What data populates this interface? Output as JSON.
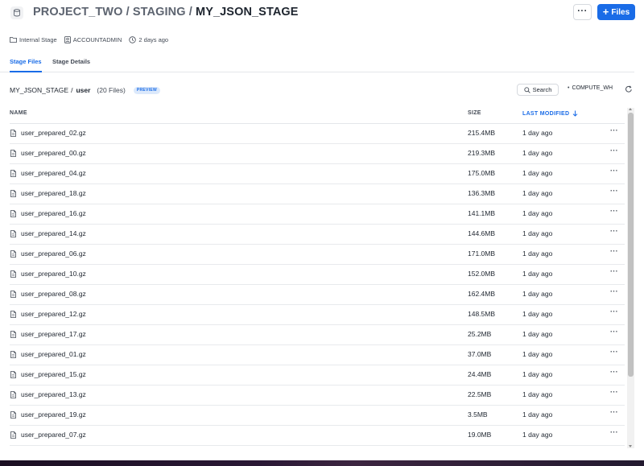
{
  "header": {
    "breadcrumb_db": "PROJECT_TWO",
    "breadcrumb_sep1": "/",
    "breadcrumb_schema": "STAGING",
    "breadcrumb_sep2": "/",
    "stage_name": "MY_JSON_STAGE",
    "more_label": "···",
    "files_button_label": "Files"
  },
  "meta": {
    "stage_type": "Internal Stage",
    "owner": "ACCOUNTADMIN",
    "created": "2 days ago"
  },
  "tabs": [
    {
      "label": "Stage Files",
      "active": true
    },
    {
      "label": "Stage Details",
      "active": false
    }
  ],
  "path": {
    "stage": "MY_JSON_STAGE",
    "separator": "/",
    "folder": "user",
    "file_count": "(20 Files)",
    "badge": "PREVIEW"
  },
  "toolbar": {
    "search_label": "Search",
    "warehouse": "COMPUTE_WH"
  },
  "table": {
    "columns": {
      "name": "NAME",
      "size": "SIZE",
      "modified": "LAST MODIFIED"
    },
    "row_menu_label": "···",
    "rows": [
      {
        "name": "user_prepared_02.gz",
        "size": "215.4MB",
        "modified": "1 day ago"
      },
      {
        "name": "user_prepared_00.gz",
        "size": "219.3MB",
        "modified": "1 day ago"
      },
      {
        "name": "user_prepared_04.gz",
        "size": "175.0MB",
        "modified": "1 day ago"
      },
      {
        "name": "user_prepared_18.gz",
        "size": "136.3MB",
        "modified": "1 day ago"
      },
      {
        "name": "user_prepared_16.gz",
        "size": "141.1MB",
        "modified": "1 day ago"
      },
      {
        "name": "user_prepared_14.gz",
        "size": "144.6MB",
        "modified": "1 day ago"
      },
      {
        "name": "user_prepared_06.gz",
        "size": "171.0MB",
        "modified": "1 day ago"
      },
      {
        "name": "user_prepared_10.gz",
        "size": "152.0MB",
        "modified": "1 day ago"
      },
      {
        "name": "user_prepared_08.gz",
        "size": "162.4MB",
        "modified": "1 day ago"
      },
      {
        "name": "user_prepared_12.gz",
        "size": "148.5MB",
        "modified": "1 day ago"
      },
      {
        "name": "user_prepared_17.gz",
        "size": "25.2MB",
        "modified": "1 day ago"
      },
      {
        "name": "user_prepared_01.gz",
        "size": "37.0MB",
        "modified": "1 day ago"
      },
      {
        "name": "user_prepared_15.gz",
        "size": "24.4MB",
        "modified": "1 day ago"
      },
      {
        "name": "user_prepared_13.gz",
        "size": "22.5MB",
        "modified": "1 day ago"
      },
      {
        "name": "user_prepared_19.gz",
        "size": "3.5MB",
        "modified": "1 day ago"
      },
      {
        "name": "user_prepared_07.gz",
        "size": "19.0MB",
        "modified": "1 day ago"
      }
    ]
  },
  "colors": {
    "accent": "#1a6ce7",
    "text": "#1e252f",
    "muted": "#434a55",
    "divider": "#e4e6ea"
  },
  "icons": {
    "stage": "database-stage-icon",
    "file": "file-icon",
    "search": "search-icon",
    "refresh": "refresh-icon",
    "sort": "arrow-down-icon",
    "row_menu": "more-horizontal-icon"
  }
}
